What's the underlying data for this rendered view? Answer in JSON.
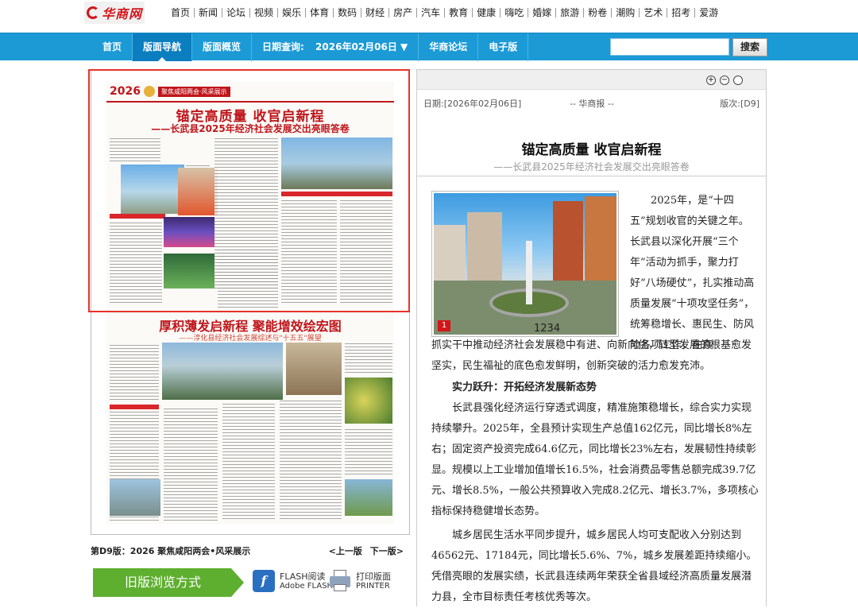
{
  "logo": {
    "text": "华商网"
  },
  "top_nav": [
    "首页",
    "新闻",
    "论坛",
    "视频",
    "娱乐",
    "体育",
    "数码",
    "财经",
    "房产",
    "汽车",
    "教育",
    "健康",
    "嗨吃",
    "婚嫁",
    "旅游",
    "粉卷",
    "潮购",
    "艺术",
    "招考",
    "爱游"
  ],
  "blue_nav": {
    "items": [
      "首页",
      "版面导航",
      "版面概览"
    ],
    "date_label": "日期查询:",
    "date_value": "2026年02月06日",
    "date_arrow": "▼",
    "extra": [
      "华商论坛",
      "电子版"
    ],
    "search_button": "搜索",
    "search_placeholder": ""
  },
  "newspaper": {
    "year": "2026",
    "section_tag": "聚焦咸阳两会·风采展示",
    "article1_title": "锚定高质量 收官启新程",
    "article1_sub": "——长武县2025年经济社会发展交出亮眼答卷",
    "article2_title": "厚积薄发启新程 聚能增效绘宏图",
    "article2_sub": "——淳化县经济社会发展综述与\"十五五\"展望"
  },
  "page_footer": {
    "page_label": "第D9版：2026 聚焦咸阳两会•风采展示",
    "prev": "<上一版",
    "next": "下一版>"
  },
  "buttons": {
    "old_version": "旧版浏览方式",
    "flash_line1": "FLASH阅读",
    "flash_line2": "Adobe FLASH",
    "print_line1": "打印版面",
    "print_line2": "PRINTER"
  },
  "article": {
    "zoom_in": "+",
    "zoom_out": "−",
    "zoom_reset": "",
    "date": "日期:[2026年02月06日]",
    "source": "-- 华商报 --",
    "page": "版次:[D9]",
    "title": "锚定高质量 收官启新程",
    "subtitle": "——长武县2025年经济社会发展交出亮眼答卷",
    "photo_caption": "1234",
    "photo_badge": "1",
    "para1_wrap": "2025年，是“十四五”规划收官的关键之年。长武县以深化开展“三个年”活动为抓手，聚力打好“八场硬仗”，扎实推动高质量发展“十项攻坚任务”，统筹稳增长、惠民生、防风险各项工作，在真",
    "para1_cont": "抓实干中推动经济社会发展稳中有进、向新向优，转型发展的根基愈发坚实，民生福祉的底色愈发鲜明，创新突破的活力愈发充沛。",
    "heading1": "实力跃升：开拓经济发展新态势",
    "para2": "长武县强化经济运行穿透式调度，精准施策稳增长，综合实力实现持续攀升。2025年，全县预计实现生产总值162亿元，同比增长8%左右；固定资产投资完成64.6亿元，同比增长23%左右，发展韧性持续彰显。规模以上工业增加值增长16.5%，社会消费品零售总额完成39.7亿元、增长8.5%，一般公共预算收入完成8.2亿元、增长3.7%，多项核心指标保持稳健增长态势。",
    "para3": "城乡居民生活水平同步提升，城乡居民人均可支配收入分别达到46562元、17184元，同比增长5.6%、7%，城乡发展差距持续缩小。凭借亮眼的发展实绩，长武县连续两年荣获全省县域经济高质量发展潜力县，全市目标责任考核优秀等次。"
  }
}
